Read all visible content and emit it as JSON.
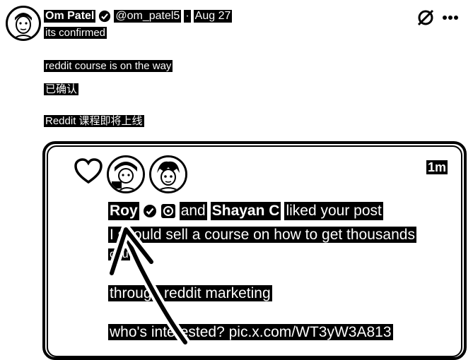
{
  "tweet": {
    "author_name": "Om Patel",
    "author_handle": "@om_patel5",
    "separator": "·",
    "date": "Aug 27",
    "line1": "its confirmed",
    "line2": "reddit course is on the way",
    "line3": "已确认",
    "line4": "Reddit 课程即将上线"
  },
  "header_icons": [
    "grok-icon",
    "more-icon"
  ],
  "notification": {
    "time": "1m",
    "user1": "Roy",
    "connector": "and",
    "user2": "Shayan C",
    "action": "liked your post",
    "post_line1": "I should sell a course on how to get thousands",
    "post_line2": "of u",
    "post_line3": "through reddit marketing",
    "post_line4": "who's interested? pic.x.com/WT3yW3A813"
  }
}
